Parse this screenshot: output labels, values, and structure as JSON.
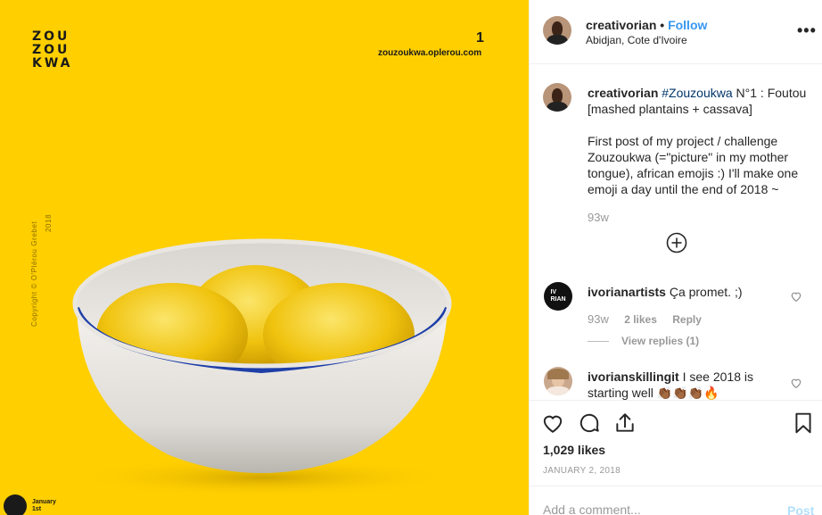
{
  "media": {
    "brand_lines": [
      "ZOU",
      "ZOU",
      "KWA"
    ],
    "page_number": "1",
    "site_url": "zouzoukwa.oplerou.com",
    "copyright": "Copyright © O'Plérou Grebet",
    "side_year": "2018",
    "date_badge": {
      "line1": "January",
      "line2": "1st"
    },
    "colors": {
      "background": "#ffcf00",
      "bowl_rim": "#1e3fa8",
      "foutou": "#f2c813"
    }
  },
  "header": {
    "username": "creativorian",
    "separator": "•",
    "follow_label": "Follow",
    "location": "Abidjan, Cote d'Ivoire",
    "more_icon": "more-options-icon"
  },
  "caption": {
    "username": "creativorian",
    "hashtag": "#Zouzoukwa",
    "text": " N°1 : Foutou [mashed plantains + cassava]\n\nFirst post of my project / challenge Zouzoukwa (=\"picture\" in my mother tongue), african emojis :) I'll make one emoji a day until the end of 2018 ~",
    "time": "93w"
  },
  "comments": [
    {
      "username": "ivorianartists",
      "avatar_text": "IV\nRIAN",
      "text": " Ça promet. ;)",
      "time": "93w",
      "likes": "2 likes",
      "reply_label": "Reply",
      "view_replies": "View replies (1)"
    },
    {
      "username": "ivorianskillingit",
      "text": " I see 2018 is starting well 👏🏾👏🏾👏🏾🔥"
    }
  ],
  "actions": {
    "likes": "1,029 likes",
    "date": "JANUARY 2, 2018"
  },
  "add_comment": {
    "placeholder": "Add a comment...",
    "post_label": "Post"
  }
}
